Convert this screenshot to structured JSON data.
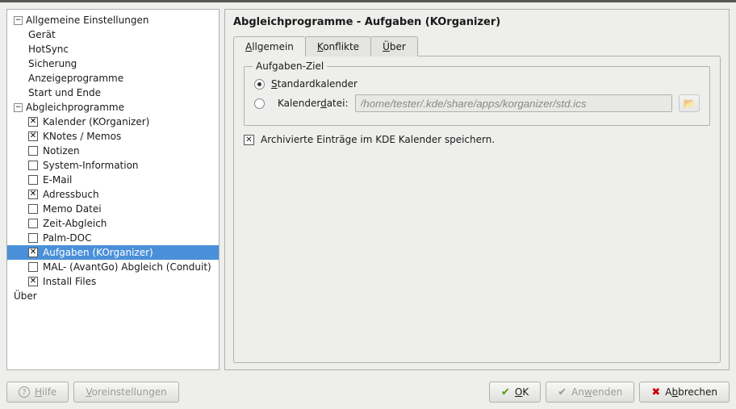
{
  "sidebar": {
    "groups": [
      {
        "label": "Allgemeine Einstellungen",
        "children": [
          {
            "label": "Gerät"
          },
          {
            "label": "HotSync"
          },
          {
            "label": "Sicherung"
          },
          {
            "label": "Anzeigeprogramme"
          },
          {
            "label": "Start und Ende"
          }
        ]
      },
      {
        "label": "Abgleichprogramme",
        "children": [
          {
            "label": "Kalender (KOrganizer)",
            "checked": true
          },
          {
            "label": "KNotes / Memos",
            "checked": true
          },
          {
            "label": "Notizen",
            "checked": false
          },
          {
            "label": "System-Information",
            "checked": false
          },
          {
            "label": "E-Mail",
            "checked": false
          },
          {
            "label": "Adressbuch",
            "checked": true
          },
          {
            "label": "Memo Datei",
            "checked": false
          },
          {
            "label": "Zeit-Abgleich",
            "checked": false
          },
          {
            "label": "Palm-DOC",
            "checked": false
          },
          {
            "label": "Aufgaben (KOrganizer)",
            "checked": true,
            "selected": true
          },
          {
            "label": "MAL- (AvantGo) Abgleich (Conduit)",
            "checked": false
          },
          {
            "label": "Install Files",
            "checked": true
          }
        ]
      },
      {
        "label": "Über"
      }
    ]
  },
  "content": {
    "title": "Abgleichprogramme - Aufgaben (KOrganizer)",
    "tabs": [
      {
        "label_pre": "",
        "label_u": "A",
        "label_post": "llgemein",
        "active": true
      },
      {
        "label_pre": "",
        "label_u": "K",
        "label_post": "onflikte"
      },
      {
        "label_pre": "",
        "label_u": "Ü",
        "label_post": "ber"
      }
    ],
    "fieldset_legend": "Aufgaben-Ziel",
    "radio_standard": {
      "pre": "",
      "u": "S",
      "post": "tandardkalender"
    },
    "radio_file": {
      "pre": "Kalender",
      "u": "d",
      "post": "atei:"
    },
    "file_path": "/home/tester/.kde/share/apps/korganizer/std.ics",
    "archive_label": {
      "pre": "",
      "u": "A",
      "post": "rchivierte Einträge im KDE Kalender speichern."
    },
    "archive_checked": true
  },
  "buttons": {
    "help": {
      "pre": "",
      "u": "H",
      "post": "ilfe"
    },
    "defaults": {
      "pre": "",
      "u": "V",
      "post": "oreinstellungen"
    },
    "ok": {
      "pre": "",
      "u": "O",
      "post": "K"
    },
    "apply": {
      "pre": "An",
      "u": "w",
      "post": "enden"
    },
    "cancel": {
      "pre": "A",
      "u": "b",
      "post": "brechen"
    }
  }
}
